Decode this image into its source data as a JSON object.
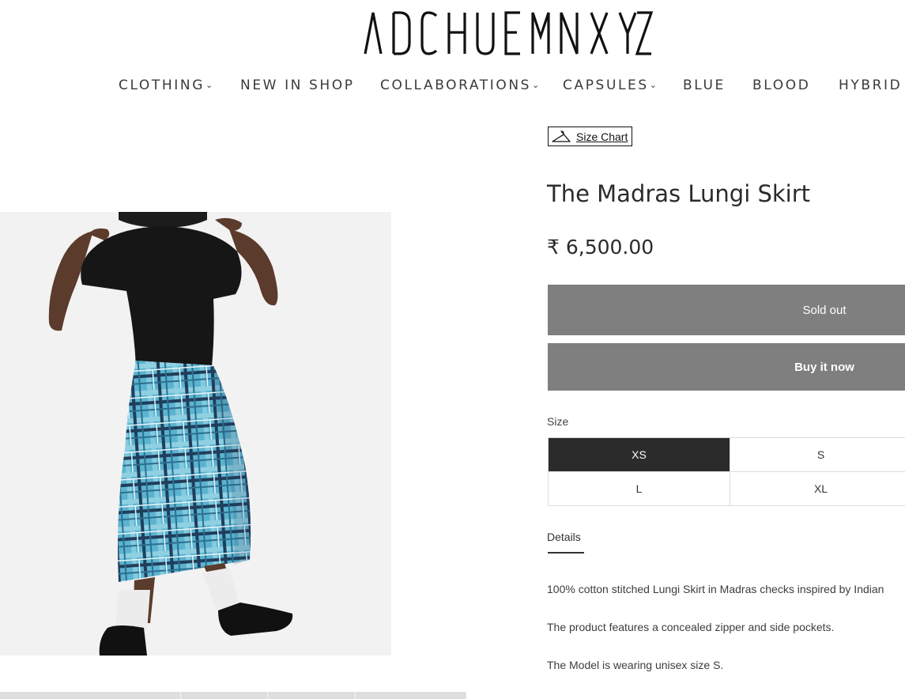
{
  "brand": {
    "logo_text": "ADCHUEMNXYZ"
  },
  "nav": {
    "items": [
      {
        "label": "CLOTHING",
        "has_dropdown": true
      },
      {
        "label": "NEW IN SHOP",
        "has_dropdown": false
      },
      {
        "label": "COLLABORATIONS",
        "has_dropdown": true
      },
      {
        "label": "CAPSULES",
        "has_dropdown": true
      },
      {
        "label": "BLUE",
        "has_dropdown": false
      },
      {
        "label": "BLOOD",
        "has_dropdown": false
      },
      {
        "label": "HYBRID",
        "has_dropdown": false
      }
    ]
  },
  "product": {
    "size_chart_label": "Size Chart",
    "size_chart_icon": "hanger-icon",
    "title": "The Madras Lungi Skirt",
    "price": "₹ 6,500.00",
    "sold_out_label": "Sold out",
    "buy_now_label": "Buy it now",
    "size_label": "Size",
    "sizes": [
      {
        "label": "XS",
        "selected": true
      },
      {
        "label": "S",
        "selected": false
      },
      {
        "label": "L",
        "selected": false
      },
      {
        "label": "XL",
        "selected": false
      }
    ],
    "details_tab_label": "Details",
    "description": [
      "100% cotton stitched Lungi Skirt in Madras checks inspired by Indian",
      "The product features a concealed zipper and side pockets.",
      "The Model is wearing unisex size S."
    ]
  },
  "colors": {
    "button_gray": "#7f7f7f",
    "selected_size": "#2b2b2b",
    "plaid_base": "#5bb3cf",
    "plaid_dark": "#1f3e5c"
  }
}
